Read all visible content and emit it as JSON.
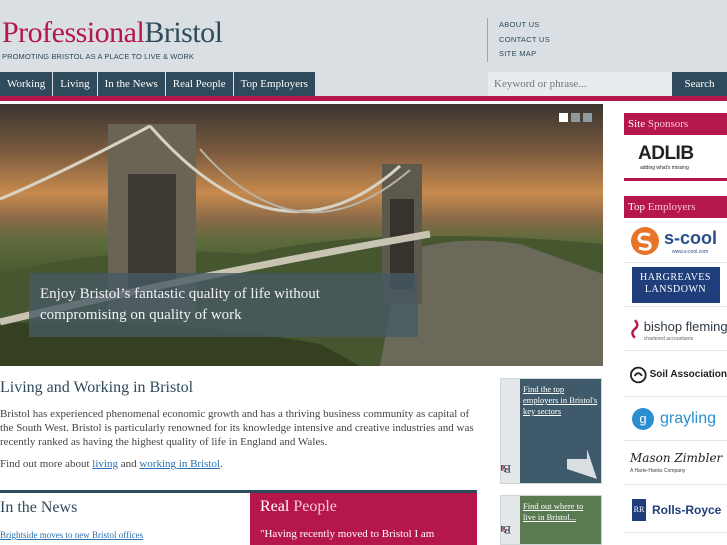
{
  "header": {
    "logo_part1": "Professional",
    "logo_part2": "Bristol",
    "tagline": "PROMOTING BRISTOL AS A PLACE TO LIVE & WORK",
    "utility_links": [
      "ABOUT US",
      "CONTACT US",
      "SITE MAP"
    ]
  },
  "nav": {
    "items": [
      "Working",
      "Living",
      "In the News",
      "Real People",
      "Top Employers"
    ],
    "search_placeholder": "Keyword or phrase...",
    "search_button": "Search"
  },
  "hero": {
    "caption": "Enjoy Bristol’s fantastic quality of life without compromising on quality of work",
    "slide_count": 3,
    "active_slide": 1
  },
  "main": {
    "title": "Living and Working in Bristol",
    "intro": "Bristol has experienced phenomenal economic growth and has a thriving business community as capital of the South West. Bristol is particularly renowned for its knowledge intensive and creative industries and was recently ranked as having the highest quality of life in England and Wales.",
    "find_more_prefix": "Find out more about",
    "find_more_link1": "living",
    "find_more_and": "and",
    "find_more_link2": "working in Bristol",
    "find_more_suffix": "."
  },
  "promos": [
    {
      "vertical_1": "Professional",
      "vertical_2": "Bristol",
      "text": "Find the top employers in Bristol's key sectors",
      "color": "#3f5a6a"
    },
    {
      "vertical_1": "Professional",
      "vertical_2": "Bristol",
      "text": "Find out where to live in Bristol...",
      "color": "#5a7a52"
    }
  ],
  "news": {
    "title": "In the News",
    "first_item": "Brightside moves to new Bristol offices"
  },
  "real_people": {
    "title_1": "Real",
    "title_2": "People",
    "quote": "\"Having recently moved to Bristol I am"
  },
  "sidebar": {
    "sponsors_head_1": "Site",
    "sponsors_head_2": "Sponsors",
    "sponsor_name": "ADLIB",
    "sponsor_tagline": "adding what's missing",
    "employers_head_1": "Top",
    "employers_head_2": "Employers",
    "employers": [
      "s-cool",
      "HARGREAVES",
      "LANSDOWN",
      "bishop fleming",
      "Soil Association",
      "grayling",
      "Rolls-Royce"
    ],
    "scool_sub": "www.s-cool.com",
    "bishop_sub": "chartered accountants",
    "mz_script": "Mason Zimbler",
    "mz_sub": "A Harte-Hanks Company"
  },
  "colors": {
    "accent": "#b5174b",
    "navy": "#2f4a5a",
    "header_bg": "#d9dfe3"
  }
}
